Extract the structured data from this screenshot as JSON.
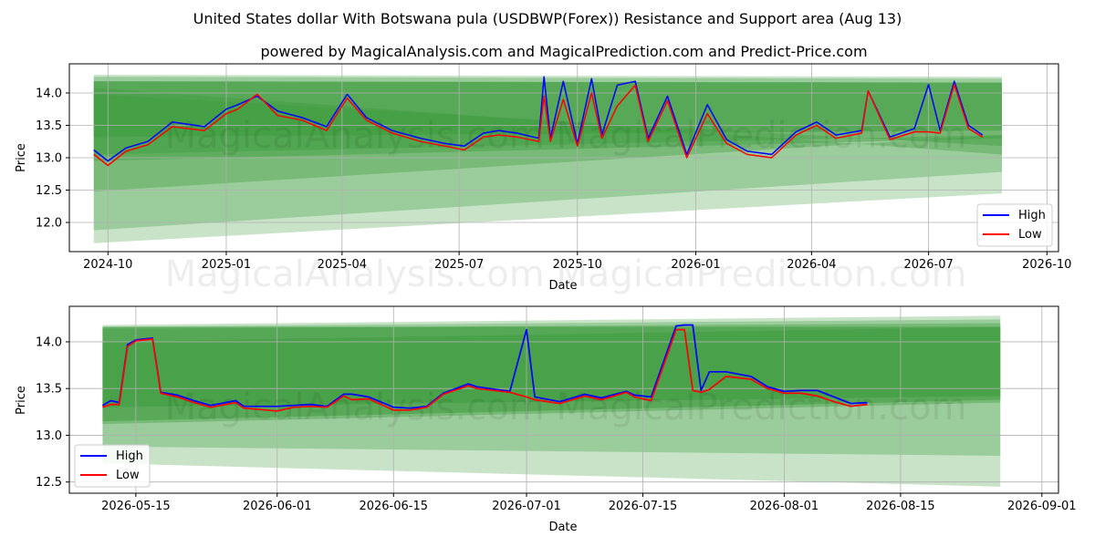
{
  "title": "United States dollar With Botswana pula (USDBWP(Forex)) Resistance and Support area (Aug 13)",
  "subtitle": "powered by MagicalAnalysis.com and MagicalPrediction.com and Predict-Price.com",
  "watermark": "MagicalAnalysis.com      MagicalPrediction.com",
  "colors": {
    "high": "#0000ff",
    "low": "#ff0000",
    "band": "#3c9a3c",
    "grid": "#b0b0b0"
  },
  "chart_data": [
    {
      "type": "line",
      "xlabel": "Date",
      "ylabel": "Price",
      "x_ticks": [
        "2024-10",
        "2025-01",
        "2025-04",
        "2025-07",
        "2025-10",
        "2026-01",
        "2026-04",
        "2026-07",
        "2026-10"
      ],
      "y_ticks": [
        "12.0",
        "12.5",
        "13.0",
        "13.5",
        "14.0"
      ],
      "ylim": [
        11.55,
        14.45
      ],
      "grid": true,
      "legend": {
        "placement": "lower-right",
        "entries": [
          "High",
          "Low"
        ]
      },
      "series": [
        {
          "name": "High",
          "x": [
            "2024-09-20",
            "2024-10-01",
            "2024-10-15",
            "2024-11-01",
            "2024-11-20",
            "2024-12-15",
            "2025-01-01",
            "2025-01-10",
            "2025-01-25",
            "2025-02-10",
            "2025-03-01",
            "2025-03-20",
            "2025-04-05",
            "2025-04-20",
            "2025-05-10",
            "2025-06-01",
            "2025-06-20",
            "2025-07-05",
            "2025-07-20",
            "2025-08-01",
            "2025-08-15",
            "2025-09-01",
            "2025-09-05",
            "2025-09-10",
            "2025-09-20",
            "2025-10-01",
            "2025-10-12",
            "2025-10-20",
            "2025-11-01",
            "2025-11-15",
            "2025-11-25",
            "2025-12-10",
            "2025-12-25",
            "2026-01-10",
            "2026-01-25",
            "2026-02-10",
            "2026-03-01",
            "2026-03-20",
            "2026-04-05",
            "2026-04-20",
            "2026-05-10",
            "2026-05-15",
            "2026-06-01",
            "2026-06-20",
            "2026-07-01",
            "2026-07-10",
            "2026-07-21",
            "2026-08-01",
            "2026-08-12"
          ],
          "values": [
            13.12,
            12.95,
            13.15,
            13.25,
            13.55,
            13.48,
            13.75,
            13.82,
            13.95,
            13.72,
            13.62,
            13.48,
            13.98,
            13.62,
            13.42,
            13.3,
            13.22,
            13.18,
            13.38,
            13.42,
            13.38,
            13.3,
            14.25,
            13.3,
            14.18,
            13.22,
            14.22,
            13.35,
            14.12,
            14.18,
            13.3,
            13.95,
            13.05,
            13.82,
            13.28,
            13.1,
            13.05,
            13.4,
            13.55,
            13.35,
            13.42,
            14.03,
            13.32,
            13.45,
            14.13,
            13.42,
            14.18,
            13.5,
            13.35
          ]
        },
        {
          "name": "Low",
          "x": [
            "2024-09-20",
            "2024-10-01",
            "2024-10-15",
            "2024-11-01",
            "2024-11-20",
            "2024-12-15",
            "2025-01-01",
            "2025-01-10",
            "2025-01-25",
            "2025-02-10",
            "2025-03-01",
            "2025-03-20",
            "2025-04-05",
            "2025-04-20",
            "2025-05-10",
            "2025-06-01",
            "2025-06-20",
            "2025-07-05",
            "2025-07-20",
            "2025-08-01",
            "2025-08-15",
            "2025-09-01",
            "2025-09-05",
            "2025-09-10",
            "2025-09-20",
            "2025-10-01",
            "2025-10-12",
            "2025-10-20",
            "2025-11-01",
            "2025-11-15",
            "2025-11-25",
            "2025-12-10",
            "2025-12-25",
            "2026-01-10",
            "2026-01-25",
            "2026-02-10",
            "2026-03-01",
            "2026-03-20",
            "2026-04-05",
            "2026-04-20",
            "2026-05-10",
            "2026-05-15",
            "2026-06-01",
            "2026-06-20",
            "2026-07-01",
            "2026-07-10",
            "2026-07-21",
            "2026-08-01",
            "2026-08-12"
          ],
          "values": [
            13.05,
            12.88,
            13.1,
            13.2,
            13.48,
            13.42,
            13.68,
            13.75,
            13.98,
            13.65,
            13.58,
            13.42,
            13.92,
            13.58,
            13.38,
            13.25,
            13.18,
            13.12,
            13.32,
            13.35,
            13.32,
            13.25,
            13.95,
            13.25,
            13.9,
            13.18,
            14.0,
            13.3,
            13.8,
            14.12,
            13.25,
            13.88,
            13.0,
            13.68,
            13.22,
            13.05,
            13.0,
            13.35,
            13.5,
            13.3,
            13.38,
            14.03,
            13.28,
            13.4,
            13.4,
            13.38,
            14.13,
            13.45,
            13.32
          ]
        }
      ]
    },
    {
      "type": "line",
      "xlabel": "Date",
      "ylabel": "Price",
      "x_ticks": [
        "2026-05-15",
        "2026-06-01",
        "2026-06-15",
        "2026-07-01",
        "2026-07-15",
        "2026-08-01",
        "2026-08-15",
        "2026-09-01"
      ],
      "y_ticks": [
        "12.5",
        "13.0",
        "13.5",
        "14.0"
      ],
      "ylim": [
        12.38,
        14.38
      ],
      "grid": true,
      "legend": {
        "placement": "lower-left",
        "entries": [
          "High",
          "Low"
        ]
      },
      "series": [
        {
          "name": "High",
          "x": [
            "2026-05-11",
            "2026-05-12",
            "2026-05-13",
            "2026-05-14",
            "2026-05-15",
            "2026-05-17",
            "2026-05-18",
            "2026-05-20",
            "2026-05-22",
            "2026-05-24",
            "2026-05-27",
            "2026-05-28",
            "2026-06-01",
            "2026-06-03",
            "2026-06-05",
            "2026-06-07",
            "2026-06-09",
            "2026-06-10",
            "2026-06-12",
            "2026-06-15",
            "2026-06-17",
            "2026-06-19",
            "2026-06-21",
            "2026-06-24",
            "2026-06-25",
            "2026-06-29",
            "2026-07-01",
            "2026-07-02",
            "2026-07-05",
            "2026-07-08",
            "2026-07-10",
            "2026-07-13",
            "2026-07-14",
            "2026-07-16",
            "2026-07-19",
            "2026-07-20",
            "2026-07-21",
            "2026-07-22",
            "2026-07-23",
            "2026-07-25",
            "2026-07-28",
            "2026-07-30",
            "2026-08-01",
            "2026-08-03",
            "2026-08-05",
            "2026-08-07",
            "2026-08-09",
            "2026-08-11"
          ],
          "values": [
            13.32,
            13.37,
            13.35,
            13.97,
            14.02,
            14.04,
            13.46,
            13.43,
            13.37,
            13.32,
            13.37,
            13.31,
            13.31,
            13.32,
            13.33,
            13.31,
            13.44,
            13.44,
            13.41,
            13.3,
            13.29,
            13.31,
            13.45,
            13.55,
            13.52,
            13.47,
            14.13,
            13.41,
            13.36,
            13.44,
            13.4,
            13.47,
            13.43,
            13.41,
            14.17,
            14.18,
            14.18,
            13.48,
            13.68,
            13.68,
            13.63,
            13.52,
            13.47,
            13.48,
            13.48,
            13.41,
            13.34,
            13.35
          ]
        },
        {
          "name": "Low",
          "x": [
            "2026-05-11",
            "2026-05-12",
            "2026-05-13",
            "2026-05-14",
            "2026-05-15",
            "2026-05-17",
            "2026-05-18",
            "2026-05-20",
            "2026-05-22",
            "2026-05-24",
            "2026-05-27",
            "2026-05-28",
            "2026-06-01",
            "2026-06-03",
            "2026-06-05",
            "2026-06-07",
            "2026-06-09",
            "2026-06-10",
            "2026-06-12",
            "2026-06-15",
            "2026-06-17",
            "2026-06-19",
            "2026-06-21",
            "2026-06-24",
            "2026-06-25",
            "2026-06-29",
            "2026-07-01",
            "2026-07-02",
            "2026-07-05",
            "2026-07-08",
            "2026-07-10",
            "2026-07-13",
            "2026-07-14",
            "2026-07-16",
            "2026-07-19",
            "2026-07-20",
            "2026-07-21",
            "2026-07-22",
            "2026-07-23",
            "2026-07-25",
            "2026-07-28",
            "2026-07-30",
            "2026-08-01",
            "2026-08-03",
            "2026-08-05",
            "2026-08-07",
            "2026-08-09",
            "2026-08-11"
          ],
          "values": [
            13.3,
            13.33,
            13.33,
            13.95,
            14.01,
            14.03,
            13.45,
            13.41,
            13.35,
            13.3,
            13.35,
            13.29,
            13.26,
            13.3,
            13.31,
            13.3,
            13.42,
            13.38,
            13.39,
            13.27,
            13.27,
            13.3,
            13.44,
            13.53,
            13.5,
            13.46,
            13.41,
            13.38,
            13.34,
            13.42,
            13.38,
            13.46,
            13.41,
            13.37,
            14.13,
            14.13,
            13.48,
            13.46,
            13.49,
            13.63,
            13.6,
            13.5,
            13.45,
            13.45,
            13.42,
            13.36,
            13.31,
            13.33
          ]
        }
      ]
    }
  ]
}
